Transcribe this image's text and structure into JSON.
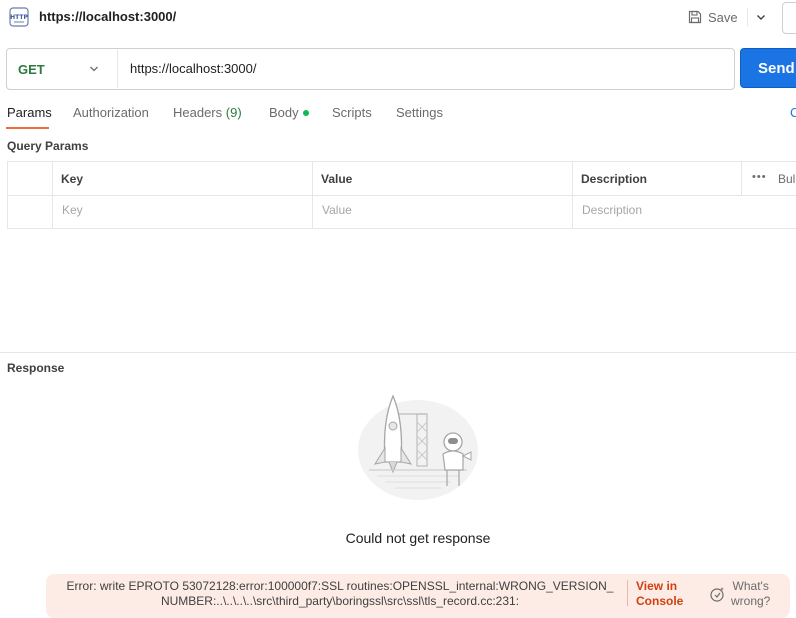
{
  "header": {
    "title": "https://localhost:3000/",
    "icon_label": "HTTP",
    "save_label": "Save"
  },
  "request": {
    "method": "GET",
    "url": "https://localhost:3000/",
    "send_label": "Send"
  },
  "tabs": {
    "params": "Params",
    "authorization": "Authorization",
    "headers": "Headers",
    "headers_count": "(9)",
    "body": "Body",
    "scripts": "Scripts",
    "settings": "Settings",
    "cookies_partial": "C"
  },
  "query_params": {
    "label": "Query Params",
    "columns": [
      "Key",
      "Value",
      "Description"
    ],
    "placeholders": [
      "Key",
      "Value",
      "Description"
    ],
    "more_icon": "ellipsis-icon",
    "bulk_label": "Bul"
  },
  "response": {
    "label": "Response",
    "empty_message": "Could not get response",
    "illustration": "rocket-astronaut-illustration"
  },
  "error": {
    "line1": "Error: write EPROTO 53072128:error:100000f7:SSL routines:OPENSSL_internal:WRONG_VERSION_",
    "line2": "NUMBER:..\\..\\..\\..\\src\\third_party\\boringssl\\src\\ssl\\tls_record.cc:231:",
    "view_console_line1": "View in",
    "view_console_line2": "Console",
    "whats_wrong_line1": "What's",
    "whats_wrong_line2": "wrong?"
  },
  "colors": {
    "accent": "#1b74e4",
    "tab_active_underline": "#f26b3a",
    "method_get": "#2c7a3e",
    "error_bg": "#fdece6",
    "error_link": "#d23f10"
  }
}
